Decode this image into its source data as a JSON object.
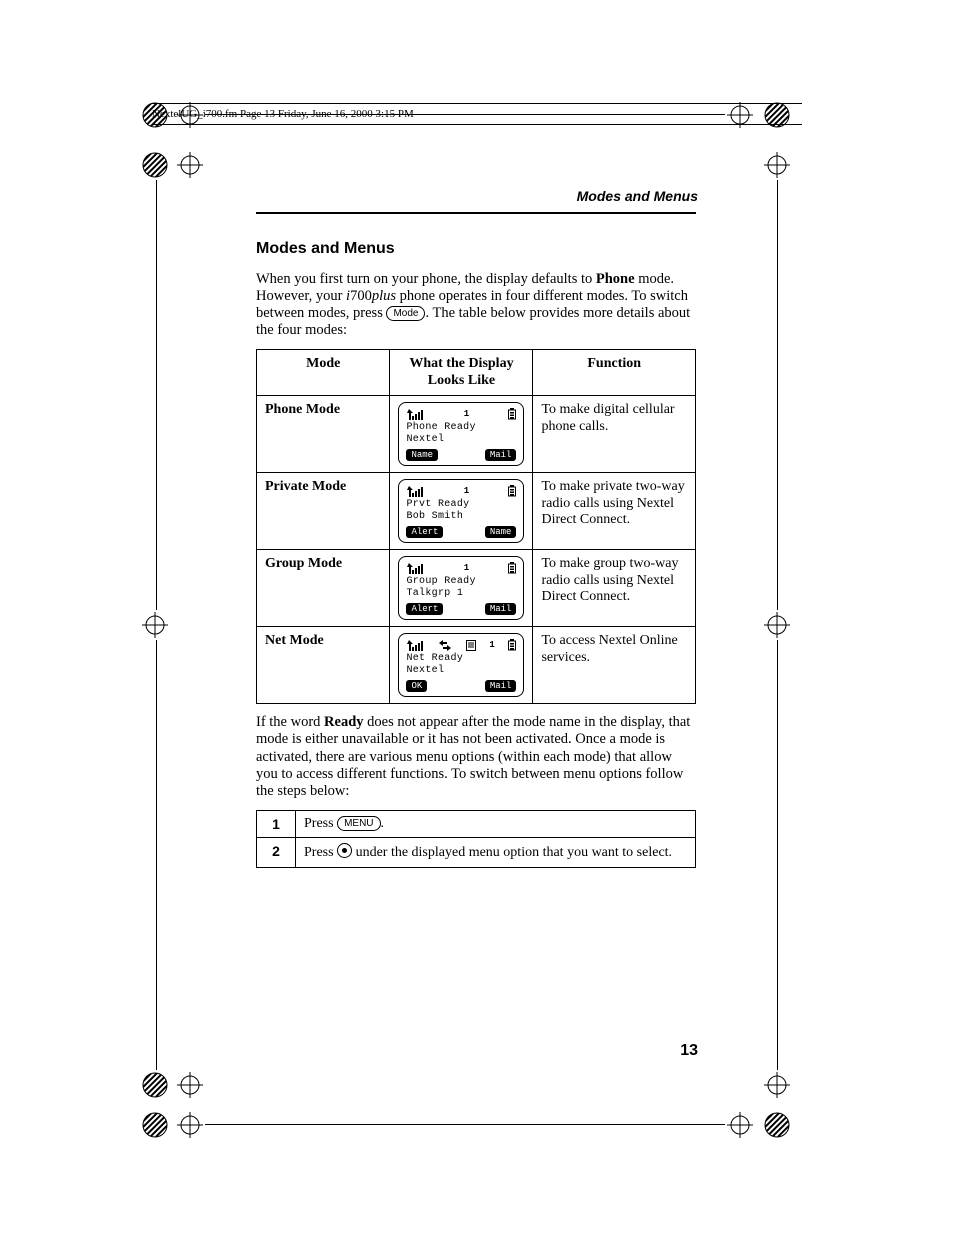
{
  "print_header": "NextelUG_i700.fm  Page 13  Friday, June 16, 2000  3:15 PM",
  "running_head": "Modes and Menus",
  "section_title": "Modes and Menus",
  "page_number": "13",
  "intro": {
    "pre": "When you first turn on your phone, the display defaults to ",
    "phone_word": "Phone",
    "mid1": " mode. However, your ",
    "model_i": "i",
    "model_num": "700",
    "model_plus": "plus",
    "mid2": " phone operates in four different modes. To switch between modes, press ",
    "key_mode": "Mode",
    "post": ". The table below provides more details about the four modes:"
  },
  "table_headers": {
    "mode": "Mode",
    "display": "What the Display Looks Like",
    "function": "Function"
  },
  "modes": [
    {
      "name": "Phone Mode",
      "lcd_num": "1",
      "lcd_line1": "Phone Ready",
      "lcd_line2": "Nextel",
      "soft_left": "Name",
      "soft_right": "Mail",
      "net_icons": false,
      "function": "To make digital cellular phone calls."
    },
    {
      "name": "Private Mode",
      "lcd_num": "1",
      "lcd_line1": "Prvt Ready",
      "lcd_line2": "Bob Smith",
      "soft_left": "Alert",
      "soft_right": "Name",
      "net_icons": false,
      "function": "To make private two-way radio calls using Nextel Direct Connect."
    },
    {
      "name": "Group Mode",
      "lcd_num": "1",
      "lcd_line1": "Group Ready",
      "lcd_line2": "Talkgrp 1",
      "soft_left": "Alert",
      "soft_right": "Mail",
      "net_icons": false,
      "function": "To make group two-way radio calls using Nextel Direct Connect."
    },
    {
      "name": "Net Mode",
      "lcd_num": "1",
      "lcd_line1": "Net Ready",
      "lcd_line2": "Nextel",
      "soft_left": "OK",
      "soft_right": "Mail",
      "net_icons": true,
      "function": "To access Nextel Online services."
    }
  ],
  "after_table": {
    "pre": "If the word ",
    "ready_word": "Ready",
    "post": " does not appear after the mode name in the display, that mode is either unavailable or it has not been activated. Once a mode is activated, there are various menu options (within each mode) that allow you to access different functions. To switch between menu options follow the steps below:"
  },
  "steps": [
    {
      "n": "1",
      "pre": "Press ",
      "key": "MENU",
      "post": "."
    },
    {
      "n": "2",
      "pre": "Press ",
      "post": " under the displayed menu option that you want to select."
    }
  ]
}
